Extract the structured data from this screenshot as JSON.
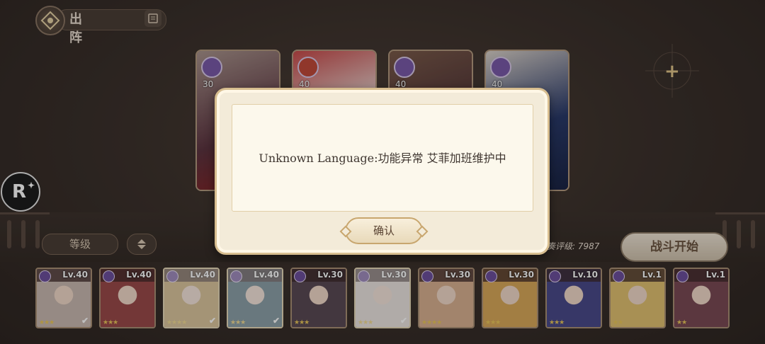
{
  "header": {
    "title": "出阵",
    "back_icon": "compass-back-icon",
    "guide_icon": "book-icon"
  },
  "team_slots": [
    {
      "level": "30",
      "class_icon": "string-class-icon",
      "color": "#8a5a6a"
    },
    {
      "level": "40",
      "class_icon": "book-class-icon",
      "color": "#8f4a4a"
    },
    {
      "level": "40",
      "class_icon": "target-class-icon",
      "color": "#6b4a52"
    },
    {
      "level": "40",
      "class_icon": "key-class-icon",
      "color": "#3e4f78"
    }
  ],
  "add_slot": {
    "label": "+"
  },
  "floating_button": {
    "label": "R",
    "icon": "sparkle-icon"
  },
  "sort": {
    "label": "等级",
    "toggle_icon": "sort-updown-icon"
  },
  "rating": {
    "text": "合奏评级: 7987"
  },
  "start_button": {
    "label": "战斗开始"
  },
  "roster": [
    {
      "level": "Lv.40",
      "stars": "★★★",
      "selected": false,
      "checked": true,
      "color": "#c9b8b0"
    },
    {
      "level": "Lv.40",
      "stars": "★★★",
      "selected": false,
      "checked": false,
      "color": "#9a4a4a"
    },
    {
      "level": "Lv.40",
      "stars": "★★★★",
      "selected": true,
      "checked": true,
      "color": "#c8a86a"
    },
    {
      "level": "Lv.40",
      "stars": "★★★",
      "selected": true,
      "checked": true,
      "color": "#4f6f7a"
    },
    {
      "level": "Lv.30",
      "stars": "★★★",
      "selected": false,
      "checked": false,
      "color": "#5a4a55"
    },
    {
      "level": "Lv.30",
      "stars": "★★★",
      "selected": true,
      "checked": true,
      "color": "#e0d8d0"
    },
    {
      "level": "Lv.30",
      "stars": "★★★★",
      "selected": false,
      "checked": false,
      "color": "#d8b090"
    },
    {
      "level": "Lv.30",
      "stars": "★★★",
      "selected": false,
      "checked": false,
      "color": "#d9a85a"
    },
    {
      "level": "Lv.10",
      "stars": "★★★",
      "selected": false,
      "checked": false,
      "color": "#4a4a8a"
    },
    {
      "level": "Lv.1",
      "stars": "★★",
      "selected": false,
      "checked": false,
      "color": "#e0c070"
    },
    {
      "level": "Lv.1",
      "stars": "★★",
      "selected": false,
      "checked": false,
      "color": "#7a4a55"
    },
    {
      "level": "",
      "stars": "★★",
      "selected": false,
      "checked": false,
      "color": "#6a4a3a"
    }
  ],
  "dialog": {
    "message": "Unknown Language:功能异常 艾菲加班维护中",
    "confirm_label": "确认"
  }
}
